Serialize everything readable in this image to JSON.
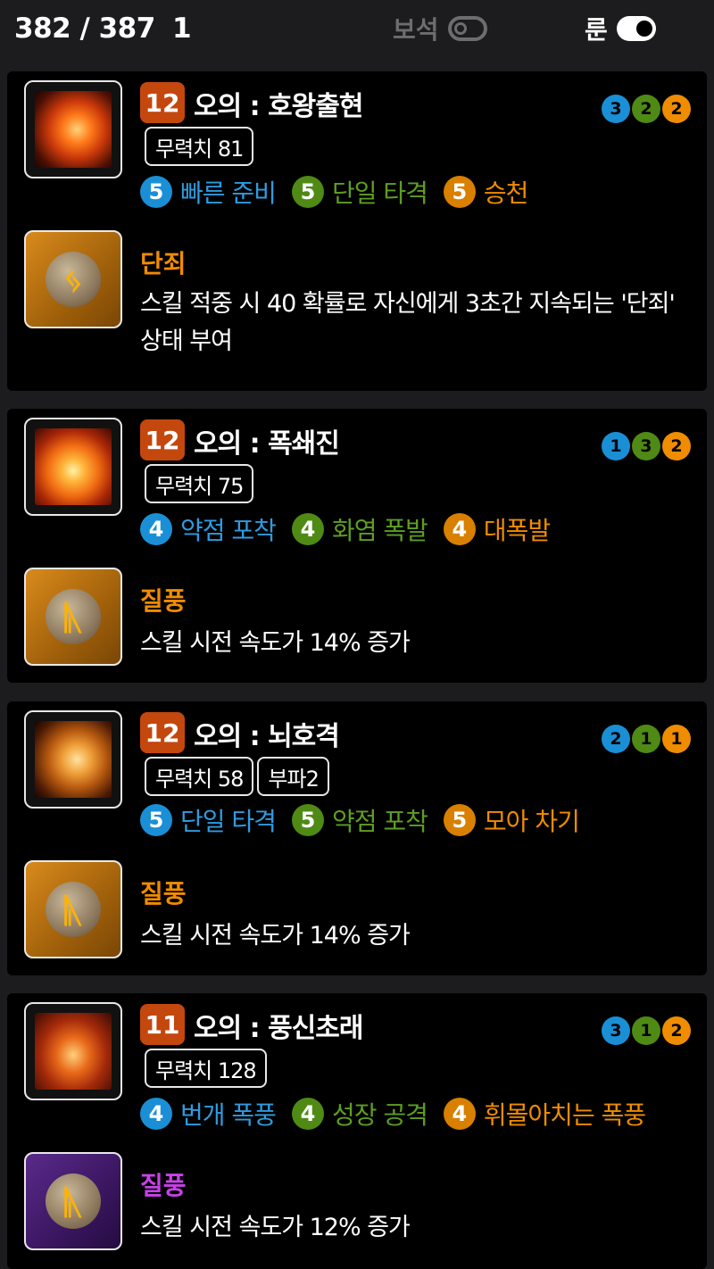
{
  "header": {
    "count": "382 / 387",
    "extra": "1",
    "gem_label": "보석",
    "gem_toggle": "off",
    "rune_label": "룬",
    "rune_toggle": "on"
  },
  "colors": {
    "tier1": "#1a8fd6",
    "tier2": "#4f8a15",
    "tier3": "#f08c00",
    "tier1_text": "#2f9be0",
    "tier2_text": "#5e9e22",
    "tier3_text": "#f08c00",
    "tier3_badge": "#d98000",
    "level_badge": "#c4470e",
    "rune_orange": "#f08c00",
    "rune_purple": "#c742e8"
  },
  "skills": [
    {
      "level": "12",
      "name": "오의 : 호왕출현",
      "gems": [
        "3",
        "2",
        "2"
      ],
      "tags": [
        "무력치 81"
      ],
      "tripods": [
        {
          "level": "5",
          "name": "빠른 준비"
        },
        {
          "level": "5",
          "name": "단일 타격"
        },
        {
          "level": "5",
          "name": "승천"
        }
      ],
      "icon": "fire-tiger-skill-icon",
      "rune": {
        "name": "단죄",
        "grade": "legendary",
        "icon": "rune-judgment-icon",
        "desc": "스킬 적중 시 40 확률로 자신에게 3초간 지속되는 '단죄' 상태 부여"
      }
    },
    {
      "level": "12",
      "name": "오의 : 폭쇄진",
      "gems": [
        "1",
        "3",
        "2"
      ],
      "tags": [
        "무력치 75"
      ],
      "tripods": [
        {
          "level": "4",
          "name": "약점 포착"
        },
        {
          "level": "4",
          "name": "화염 폭발"
        },
        {
          "level": "4",
          "name": "대폭발"
        }
      ],
      "icon": "explosion-skill-icon",
      "rune": {
        "name": "질풍",
        "grade": "legendary",
        "icon": "rune-gale-icon",
        "desc": "스킬 시전 속도가 14% 증가"
      }
    },
    {
      "level": "12",
      "name": "오의 : 뇌호격",
      "gems": [
        "2",
        "1",
        "1"
      ],
      "tags": [
        "무력치 58",
        "부파2"
      ],
      "tripods": [
        {
          "level": "5",
          "name": "단일 타격"
        },
        {
          "level": "5",
          "name": "약점 포착"
        },
        {
          "level": "5",
          "name": "모아 차기"
        }
      ],
      "icon": "lightning-tiger-skill-icon",
      "rune": {
        "name": "질풍",
        "grade": "legendary",
        "icon": "rune-gale-icon",
        "desc": "스킬 시전 속도가 14% 증가"
      }
    },
    {
      "level": "11",
      "name": "오의 : 풍신초래",
      "gems": [
        "3",
        "1",
        "2"
      ],
      "tags": [
        "무력치 128"
      ],
      "tripods": [
        {
          "level": "4",
          "name": "번개 폭풍"
        },
        {
          "level": "4",
          "name": "성장 공격"
        },
        {
          "level": "4",
          "name": "휘몰아치는 폭풍"
        }
      ],
      "icon": "tornado-skill-icon",
      "rune": {
        "name": "질풍",
        "grade": "epic",
        "icon": "rune-gale-icon",
        "desc": "스킬 시전 속도가 12% 증가"
      }
    }
  ]
}
